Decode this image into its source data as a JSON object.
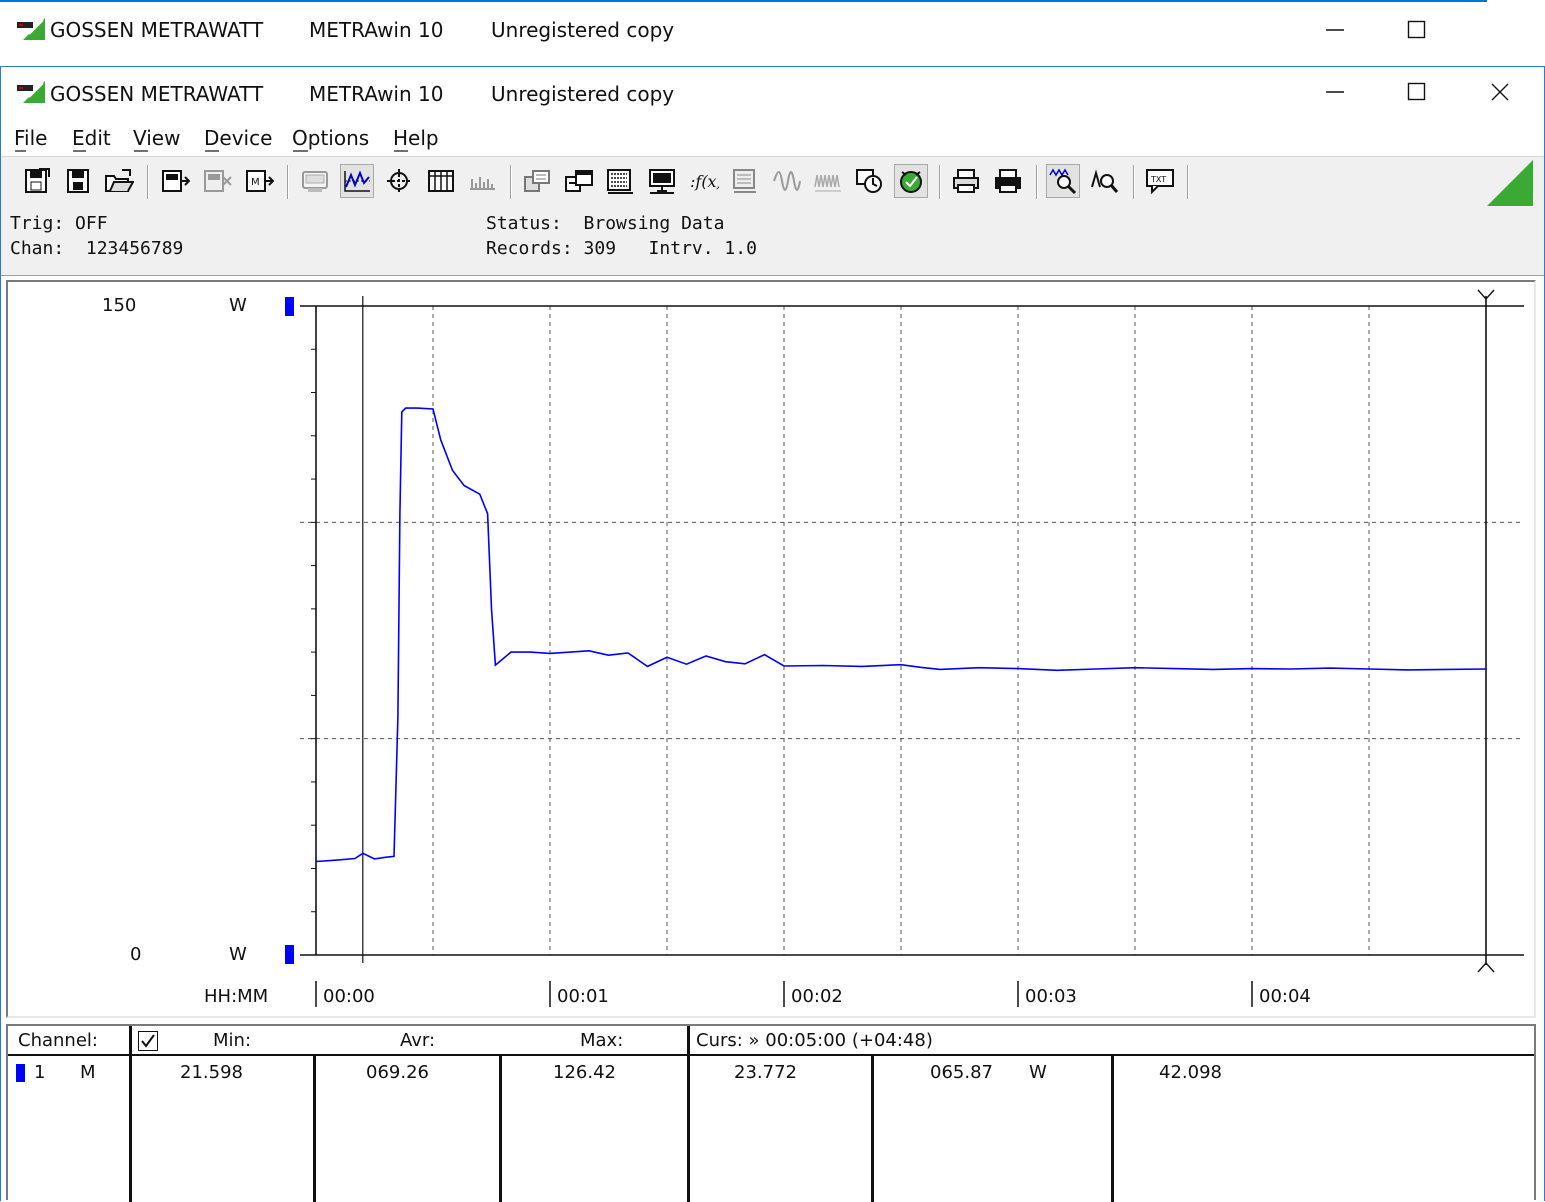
{
  "window_back": {
    "brand": "GOSSEN METRAWATT",
    "app": "METRAwin 10",
    "license": "Unregistered copy"
  },
  "window": {
    "brand": "GOSSEN METRAWATT",
    "app": "METRAwin 10",
    "license": "Unregistered copy"
  },
  "menu": [
    "File",
    "Edit",
    "View",
    "Device",
    "Options",
    "Help"
  ],
  "toolbar": {
    "icons": [
      "save-icon",
      "save-as-icon",
      "open-folder-icon",
      "device-read-icon",
      "device-config-icon",
      "device-memory-icon",
      "display-icon",
      "online-graph-icon",
      "crosshair-icon",
      "table-icon",
      "bar-scale-icon",
      "export-icon",
      "multi-window-icon",
      "grid-data-icon",
      "computer-icon",
      "formula-icon",
      "device-list-icon",
      "waveform-icon",
      "waveform-dim-icon",
      "clock-icon",
      "green-status-icon",
      "printer-icon",
      "print-preview-icon",
      "zoom-wave-icon",
      "zoom-cursor-icon",
      "comment-icon"
    ]
  },
  "status": {
    "trig": "Trig: OFF",
    "chan": "Chan:  123456789",
    "state": "Status:  Browsing Data",
    "records": "Records: 309   Intrv. 1.0"
  },
  "chart_data": {
    "type": "line",
    "ylabel_top": "150",
    "ylabel_bottom": "0",
    "unit_top": "W",
    "unit_bottom": "W",
    "xlabel": "HH:MM",
    "ylim": [
      0,
      150
    ],
    "xlim_seconds": [
      0,
      300
    ],
    "x_ticks": [
      "00:00",
      "00:01",
      "00:02",
      "00:03",
      "00:04"
    ],
    "grid": true,
    "cursor_start_s": 12,
    "cursor_end_s": 300,
    "series": [
      {
        "color": "#0000ff",
        "x": [
          0,
          5,
          10,
          12,
          15,
          18,
          20,
          21,
          21.5,
          22,
          23,
          26,
          30,
          32,
          35,
          38,
          42,
          44,
          45,
          46,
          48,
          50,
          55,
          60,
          70,
          75,
          80,
          85,
          90,
          95,
          100,
          105,
          110,
          115,
          120,
          130,
          140,
          150,
          155,
          160,
          170,
          180,
          190,
          200,
          210,
          220,
          230,
          240,
          250,
          260,
          270,
          280,
          290,
          300
        ],
        "y": [
          21.6,
          21.9,
          22.3,
          23.5,
          22.2,
          22.6,
          22.8,
          55,
          102,
          125.5,
          126.4,
          126.4,
          126.2,
          119,
          112,
          108.5,
          106.5,
          102,
          80,
          67,
          68.5,
          70,
          70,
          69.7,
          70.3,
          69.3,
          69.8,
          66.7,
          68.8,
          67.2,
          69.1,
          67.8,
          67.3,
          69.4,
          66.8,
          66.9,
          66.7,
          67.1,
          66.5,
          66.0,
          66.4,
          66.2,
          65.8,
          66.1,
          66.4,
          66.2,
          66.0,
          66.2,
          66.1,
          66.3,
          66.1,
          65.9,
          66.0,
          66.1
        ]
      }
    ]
  },
  "table": {
    "headers": {
      "channel": "Channel:",
      "min": "Min:",
      "avr": "Avr:",
      "max": "Max:",
      "cursor": "Curs: » 00:05:00 (+04:48)"
    },
    "row": {
      "num": "1",
      "mode": "M",
      "min": "21.598",
      "avr": "069.26",
      "max": "126.42",
      "c1": "23.772",
      "c2": "065.87",
      "unit": "W",
      "c3": "42.098"
    }
  }
}
